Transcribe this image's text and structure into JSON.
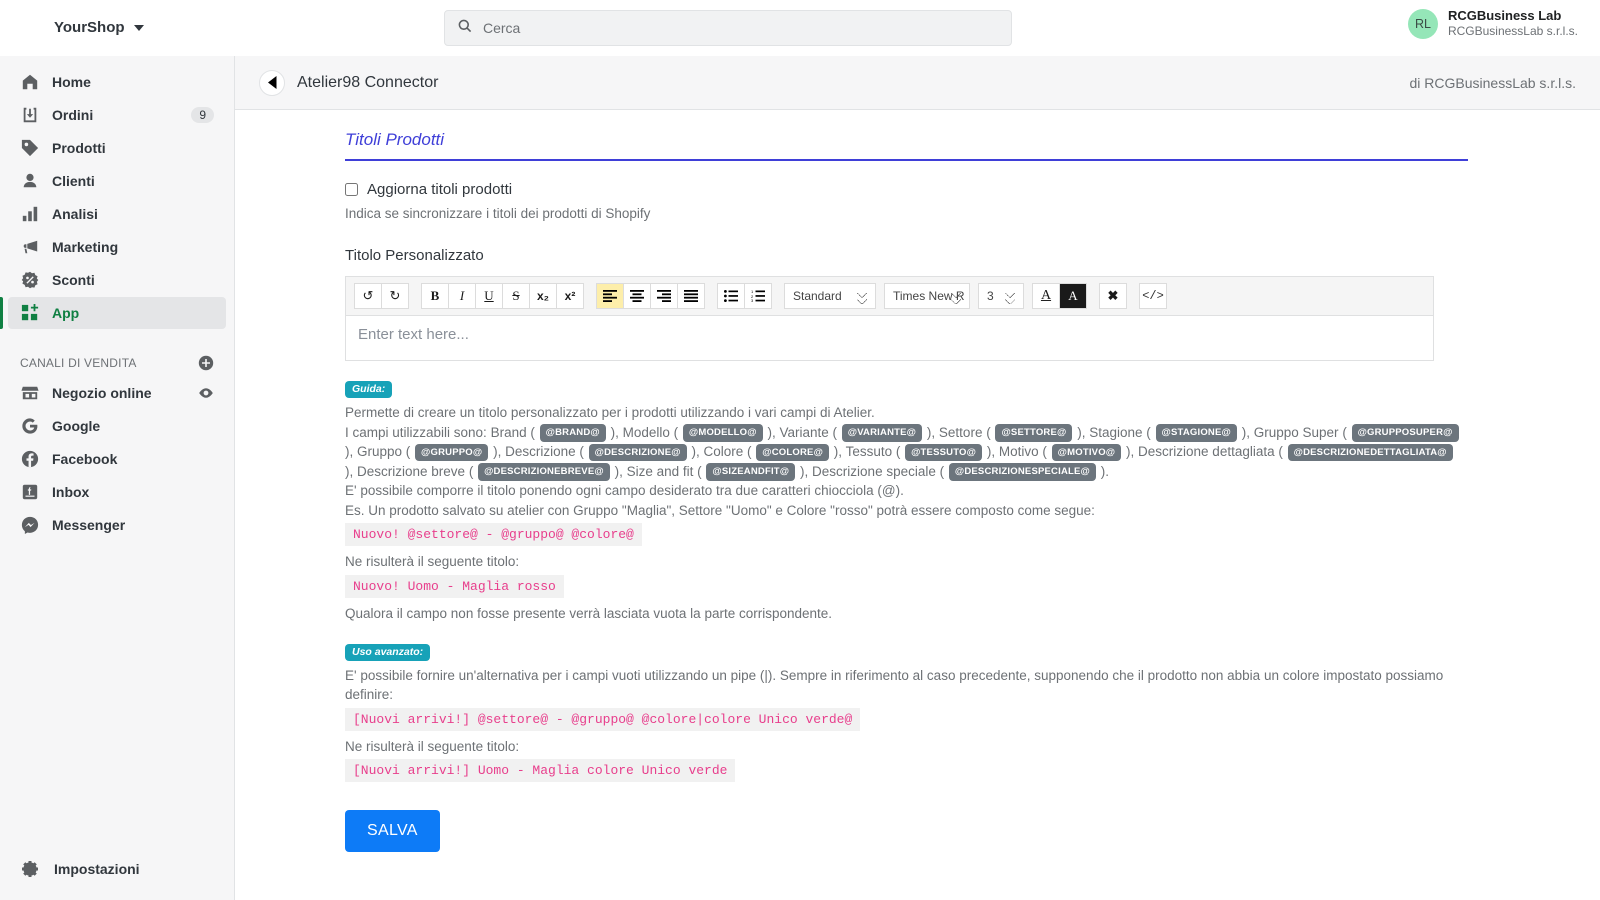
{
  "topbar": {
    "shop_name": "YourShop",
    "search_placeholder": "Cerca",
    "search_value": "",
    "user": {
      "initials": "RL",
      "name": "RCGBusiness Lab",
      "company": "RCGBusinessLab s.r.l.s."
    }
  },
  "sidebar": {
    "items": [
      {
        "label": "Home",
        "icon": "home-icon",
        "badge": ""
      },
      {
        "label": "Ordini",
        "icon": "orders-icon",
        "badge": "9"
      },
      {
        "label": "Prodotti",
        "icon": "products-tag-icon",
        "badge": ""
      },
      {
        "label": "Clienti",
        "icon": "customers-person-icon",
        "badge": ""
      },
      {
        "label": "Analisi",
        "icon": "analytics-bars-icon",
        "badge": ""
      },
      {
        "label": "Marketing",
        "icon": "marketing-megaphone-icon",
        "badge": ""
      },
      {
        "label": "Sconti",
        "icon": "discounts-percent-icon",
        "badge": ""
      },
      {
        "label": "App",
        "icon": "apps-grid-plus-icon",
        "badge": ""
      }
    ],
    "channels_title": "CANALI DI VENDITA",
    "channels": [
      {
        "label": "Negozio online",
        "icon": "storefront-icon"
      },
      {
        "label": "Google",
        "icon": "google-g-icon"
      },
      {
        "label": "Facebook",
        "icon": "facebook-icon"
      },
      {
        "label": "Inbox",
        "icon": "shopify-inbox-icon"
      },
      {
        "label": "Messenger",
        "icon": "messenger-icon"
      }
    ],
    "settings_label": "Impostazioni"
  },
  "app_header": {
    "title": "Atelier98 Connector",
    "author": "di RCGBusinessLab s.r.l.s."
  },
  "main": {
    "section_heading": "Titoli Prodotti",
    "checkbox_label": "Aggiorna titoli prodotti",
    "checkbox_checked": false,
    "help_text": "Indica se sincronizzare i titoli dei prodotti di Shopify",
    "field_label": "Titolo Personalizzato",
    "save_label": "SALVA"
  },
  "editor": {
    "placeholder": "Enter text here...",
    "value": "",
    "toolbar": {
      "undo": "↺",
      "redo": "↻",
      "bold": "B",
      "italic": "I",
      "underline": "U",
      "strike": "S",
      "subscript": "x₂",
      "superscript": "x²",
      "align_left": "align-left-icon",
      "align_center": "align-center-icon",
      "align_right": "align-right-icon",
      "align_justify": "align-justify-icon",
      "list_unordered": "bullet-list-icon",
      "list_ordered": "numbered-list-icon",
      "style_value": "Standard",
      "style_options": [
        "Standard"
      ],
      "font_value": "Times New R",
      "font_options": [
        "Times New R"
      ],
      "size_value": "3",
      "size_options": [
        "3"
      ],
      "font_color": "A",
      "back_color": "A",
      "clear_format": "✖",
      "source_code": "</>"
    },
    "active_button": "align-left"
  },
  "guide": {
    "badge": "Guida:",
    "intro": "Permette di creare un titolo personalizzato per i prodotti utilizzando i vari campi di Atelier.",
    "fields_prefix": "I campi utilizzabili sono:",
    "fields": [
      {
        "name": "Brand",
        "token": "@BRAND@"
      },
      {
        "name": "Modello",
        "token": "@MODELLO@"
      },
      {
        "name": "Variante",
        "token": "@VARIANTE@"
      },
      {
        "name": "Settore",
        "token": "@SETTORE@"
      },
      {
        "name": "Stagione",
        "token": "@STAGIONE@"
      },
      {
        "name": "Gruppo Super",
        "token": "@GRUPPOSUPER@"
      },
      {
        "name": "Gruppo",
        "token": "@GRUPPO@"
      },
      {
        "name": "Descrizione",
        "token": "@DESCRIZIONE@"
      },
      {
        "name": "Colore",
        "token": "@COLORE@"
      },
      {
        "name": "Tessuto",
        "token": "@TESSUTO@"
      },
      {
        "name": "Motivo",
        "token": "@MOTIVO@"
      },
      {
        "name": "Descrizione dettagliata",
        "token": "@DESCRIZIONEDETTAGLIATA@"
      },
      {
        "name": "Descrizione breve",
        "token": "@DESCRIZIONEBREVE@"
      },
      {
        "name": "Size and fit",
        "token": "@SIZEANDFIT@"
      },
      {
        "name": "Descrizione speciale",
        "token": "@DESCRIZIONESPECIALE@"
      }
    ],
    "rule_line": "E' possibile comporre il titolo ponendo ogni campo desiderato tra due caratteri chiocciola (@).",
    "example_intro": "Es. Un prodotto salvato su atelier con Gruppo \"Maglia\", Settore \"Uomo\" e Colore \"rosso\" potrà essere composto come segue:",
    "example_code": "Nuovo! @settore@ - @gruppo@ @colore@",
    "result_intro": "Ne risulterà il seguente titolo:",
    "example_result": "Nuovo! Uomo - Maglia rosso",
    "empty_note": "Qualora il campo non fosse presente verrà lasciata vuota la parte corrispondente.",
    "advanced_badge": "Uso avanzato:",
    "advanced_intro": "E' possibile fornire un'alternativa per i campi vuoti utilizzando un pipe (|). Sempre in riferimento al caso precedente, supponendo che il prodotto non abbia un colore impostato possiamo definire:",
    "advanced_code": "[Nuovi arrivi!] @settore@ - @gruppo@ @colore|colore Unico verde@",
    "advanced_result_intro": "Ne risulterà il seguente titolo:",
    "advanced_result": "[Nuovi arrivi!] Uomo - Maglia colore Unico verde"
  },
  "colors": {
    "accent_green": "#108043",
    "heading_blue": "#3f3fd8",
    "save_blue": "#0d7bf7",
    "badge_teal": "#17a2b8",
    "token_gray": "#6c757d",
    "code_pink": "#e83e8c",
    "toolbar_active": "#fdeeaa"
  }
}
